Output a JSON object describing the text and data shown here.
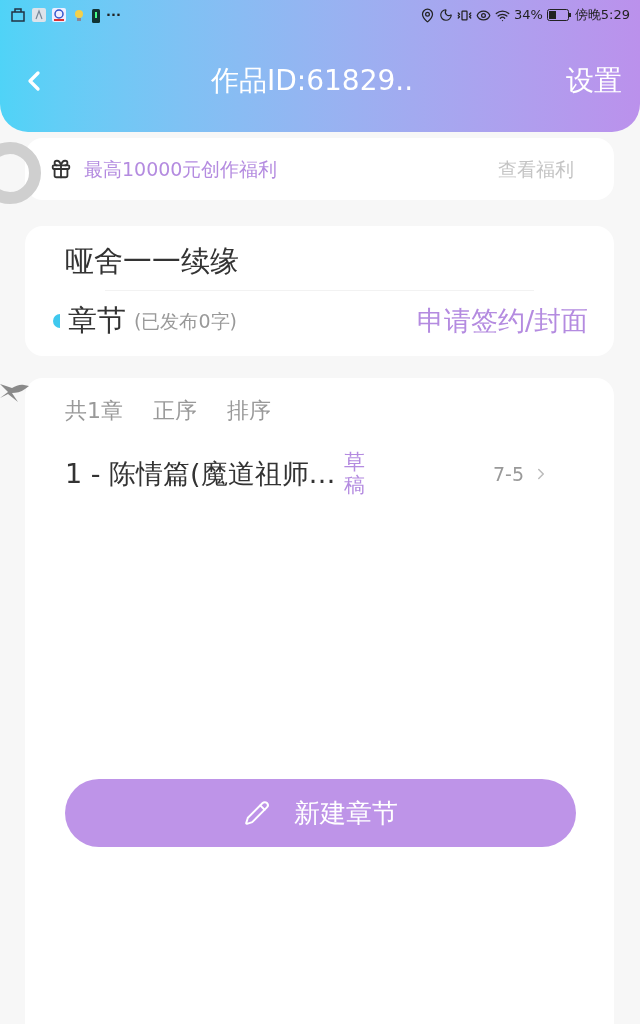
{
  "status_bar": {
    "battery": "34%",
    "time": "傍晚5:29",
    "more": "···"
  },
  "header": {
    "title": "作品ID:61829..",
    "settings": "设置"
  },
  "welfare": {
    "text": "最高10000元创作福利",
    "link": "查看福利"
  },
  "work": {
    "title": "哑舍一一续缘",
    "section_label": "章节",
    "published": "(已发布0字)",
    "apply_link": "申请签约/封面"
  },
  "chapters": {
    "count": "共1章",
    "order": "正序",
    "sort": "排序",
    "items": [
      {
        "title": "1 - 陈情篇(魔道祖师…",
        "status": "草稿",
        "date": "7-5"
      }
    ]
  },
  "new_button": "新建章节"
}
